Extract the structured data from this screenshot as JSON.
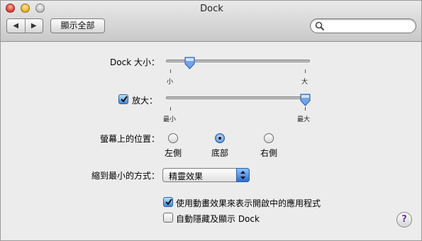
{
  "window": {
    "title": "Dock"
  },
  "toolbar": {
    "back_icon": "triangle-left",
    "forward_icon": "triangle-right",
    "show_all_label": "顯示全部",
    "search": {
      "value": "",
      "placeholder": ""
    }
  },
  "size": {
    "label": "Dock 大小：",
    "min_label": "小",
    "max_label": "大",
    "value_fraction": 0.14
  },
  "magnification": {
    "label": "放大：",
    "checked": true,
    "min_label": "最小",
    "max_label": "最大",
    "value_fraction": 1.0
  },
  "position": {
    "label": "螢幕上的位置：",
    "options": [
      "左側",
      "底部",
      "右側"
    ],
    "selected": "底部"
  },
  "minimize": {
    "label": "縮到最小的方式：",
    "selected": "精靈效果"
  },
  "options": {
    "animate_label": "使用動畫效果來表示開啟中的應用程式",
    "animate_checked": true,
    "autohide_label": "自動隱藏及顯示 Dock",
    "autohide_checked": false
  },
  "help_label": "?"
}
